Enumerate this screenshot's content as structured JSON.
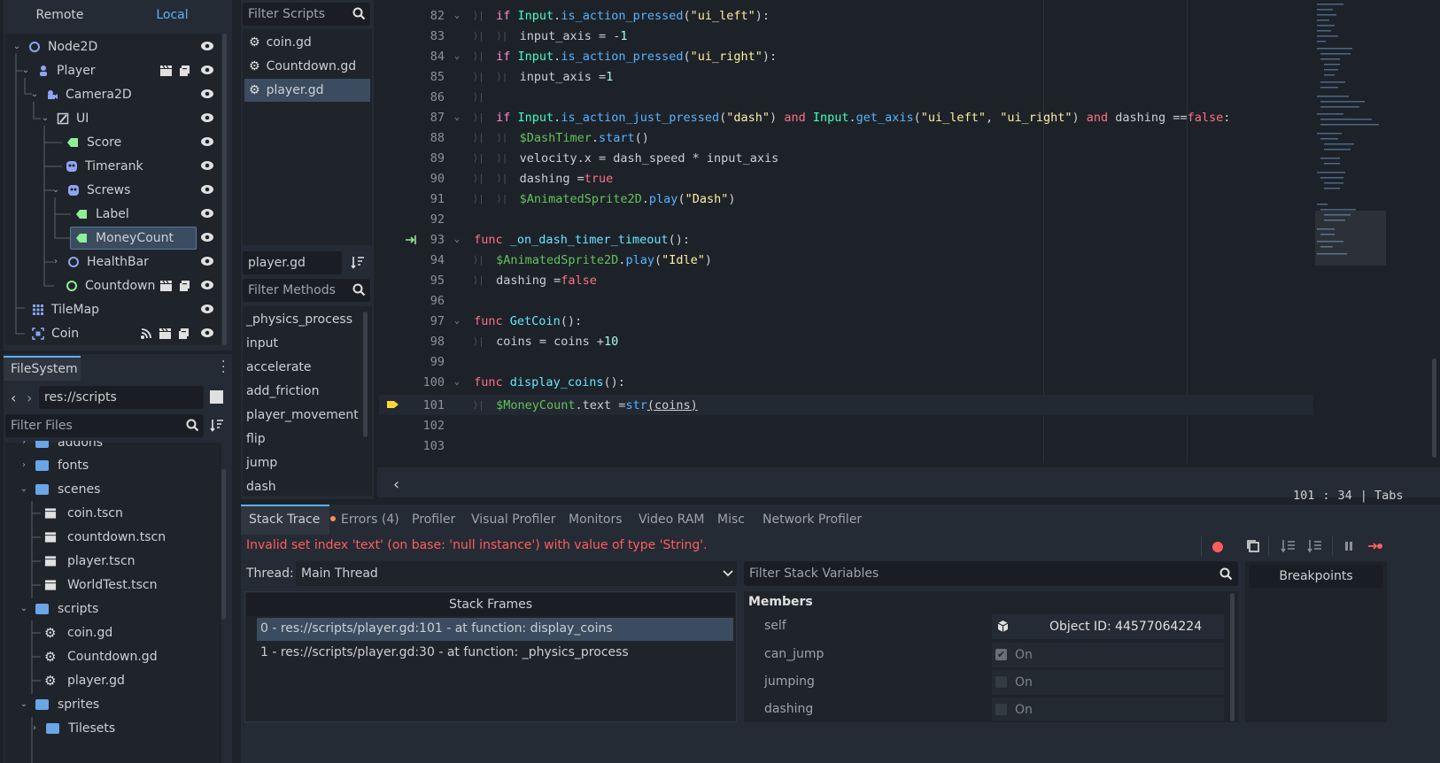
{
  "scene": {
    "tabs": [
      "Remote",
      "Local"
    ],
    "nodes": [
      {
        "label": "Node2D",
        "icon": "node2d-icon"
      },
      {
        "label": "Player",
        "icon": "character-icon"
      },
      {
        "label": "Camera2D",
        "icon": "camera-icon"
      },
      {
        "label": "UI",
        "icon": "control-icon"
      },
      {
        "label": "Score",
        "icon": "label-icon"
      },
      {
        "label": "Timerank",
        "icon": "sprite-icon"
      },
      {
        "label": "Screws",
        "icon": "sprite-icon"
      },
      {
        "label": "Label",
        "icon": "label-icon"
      },
      {
        "label": "MoneyCount",
        "icon": "label-icon"
      },
      {
        "label": "HealthBar",
        "icon": "node2d-icon"
      },
      {
        "label": "Countdown",
        "icon": "node-icon"
      },
      {
        "label": "TileMap",
        "icon": "tilemap-icon"
      },
      {
        "label": "Coin",
        "icon": "area-icon"
      }
    ]
  },
  "filesystem": {
    "tab": "FileSystem",
    "path": "res://scripts",
    "filter_placeholder": "Filter Files",
    "items": [
      {
        "label": "addons",
        "type": "folder"
      },
      {
        "label": "fonts",
        "type": "folder"
      },
      {
        "label": "scenes",
        "type": "folder"
      },
      {
        "label": "coin.tscn",
        "type": "scene"
      },
      {
        "label": "countdown.tscn",
        "type": "scene"
      },
      {
        "label": "player.tscn",
        "type": "scene"
      },
      {
        "label": "WorldTest.tscn",
        "type": "scene"
      },
      {
        "label": "scripts",
        "type": "folder"
      },
      {
        "label": "coin.gd",
        "type": "script"
      },
      {
        "label": "Countdown.gd",
        "type": "script"
      },
      {
        "label": "player.gd",
        "type": "script"
      },
      {
        "label": "sprites",
        "type": "folder"
      },
      {
        "label": "Tilesets",
        "type": "folder"
      }
    ]
  },
  "scripts": {
    "filter_placeholder": "Filter Scripts",
    "items": [
      "coin.gd",
      "Countdown.gd",
      "player.gd"
    ],
    "current": "player.gd",
    "methods_placeholder": "Filter Methods",
    "methods": [
      "_physics_process",
      "input",
      "accelerate",
      "add_friction",
      "player_movement",
      "flip",
      "jump",
      "dash"
    ]
  },
  "code": {
    "lines": [
      {
        "n": "82",
        "fold": true,
        "indent": 1
      },
      {
        "n": "83",
        "fold": false,
        "indent": 2
      },
      {
        "n": "84",
        "fold": true,
        "indent": 1
      },
      {
        "n": "85",
        "fold": false,
        "indent": 2
      },
      {
        "n": "86",
        "fold": false,
        "indent": 1
      },
      {
        "n": "87",
        "fold": true,
        "indent": 1
      },
      {
        "n": "88",
        "fold": false,
        "indent": 2
      },
      {
        "n": "89",
        "fold": false,
        "indent": 2
      },
      {
        "n": "90",
        "fold": false,
        "indent": 2
      },
      {
        "n": "91",
        "fold": false,
        "indent": 2
      },
      {
        "n": "92",
        "fold": false,
        "indent": 0
      },
      {
        "n": "93",
        "fold": true,
        "indent": 0
      },
      {
        "n": "94",
        "fold": false,
        "indent": 1
      },
      {
        "n": "95",
        "fold": false,
        "indent": 1
      },
      {
        "n": "96",
        "fold": false,
        "indent": 0
      },
      {
        "n": "97",
        "fold": true,
        "indent": 0
      },
      {
        "n": "98",
        "fold": false,
        "indent": 1
      },
      {
        "n": "99",
        "fold": false,
        "indent": 0
      },
      {
        "n": "100",
        "fold": true,
        "indent": 0
      },
      {
        "n": "101",
        "fold": false,
        "indent": 1
      },
      {
        "n": "102",
        "fold": false,
        "indent": 0
      },
      {
        "n": "103",
        "fold": false,
        "indent": 0
      }
    ],
    "cursor": {
      "line": "101",
      "sep": ":",
      "col": "34",
      "mode": "| Tabs"
    }
  },
  "debugger": {
    "tabs": [
      "Stack Trace",
      "Errors (4)",
      "Profiler",
      "Visual Profiler",
      "Monitors",
      "Video RAM",
      "Misc",
      "Network Profiler"
    ],
    "error": "Invalid set index 'text' (on base: 'null instance') with value of type 'String'.",
    "thread_label": "Thread:",
    "thread_value": "Main Thread",
    "frames_header": "Stack Frames",
    "frames": [
      "0 - res://scripts/player.gd:101 - at function: display_coins",
      "1 - res://scripts/player.gd:30 - at function: _physics_process"
    ],
    "vars_placeholder": "Filter Stack Variables",
    "members_label": "Members",
    "vars": [
      {
        "name": "self",
        "value": "Object ID: 44577064224"
      },
      {
        "name": "can_jump",
        "value": "On"
      },
      {
        "name": "jumping",
        "value": "On"
      },
      {
        "name": "dashing",
        "value": "On"
      }
    ],
    "breakpoints": "Breakpoints"
  },
  "colors": {
    "accent": "#57b3ff",
    "error": "#ff5d5d",
    "selected": "#3b4b60"
  }
}
